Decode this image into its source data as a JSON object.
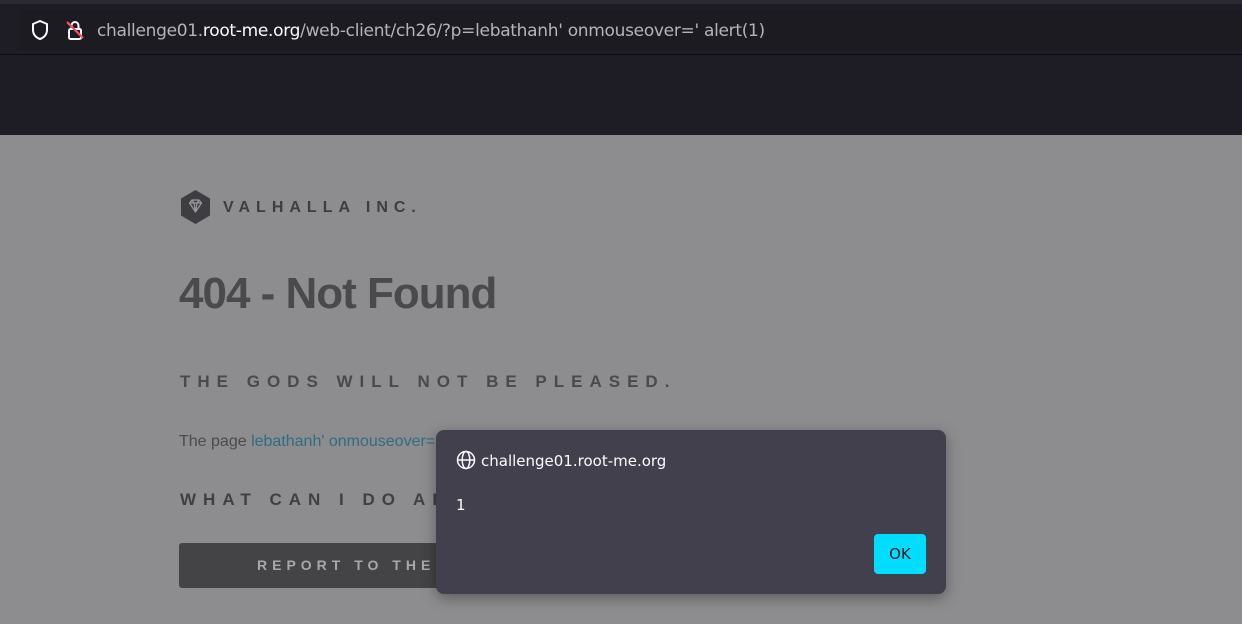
{
  "browser": {
    "url_prefix": "challenge01.",
    "url_domain": "root-me.org",
    "url_path": "/web-client/ch26/?p=lebathanh' onmouseover=' alert(1)"
  },
  "page": {
    "brand": "VALHALLA INC.",
    "title": "404 - Not Found",
    "subtitle": "THE GODS WILL NOT BE PLEASED.",
    "para_prefix": "The page ",
    "para_link": "lebathanh' onmouseover=",
    "question": "WHAT CAN I DO AB",
    "report_button": "REPORT TO THE"
  },
  "dialog": {
    "origin": "challenge01.root-me.org",
    "message": "1",
    "ok_label": "OK"
  },
  "colors": {
    "dialog_bg": "#42404c",
    "ok_button": "#00ddff",
    "page_bg": "#8d8d8f",
    "browser_bg": "#1e1c24"
  }
}
